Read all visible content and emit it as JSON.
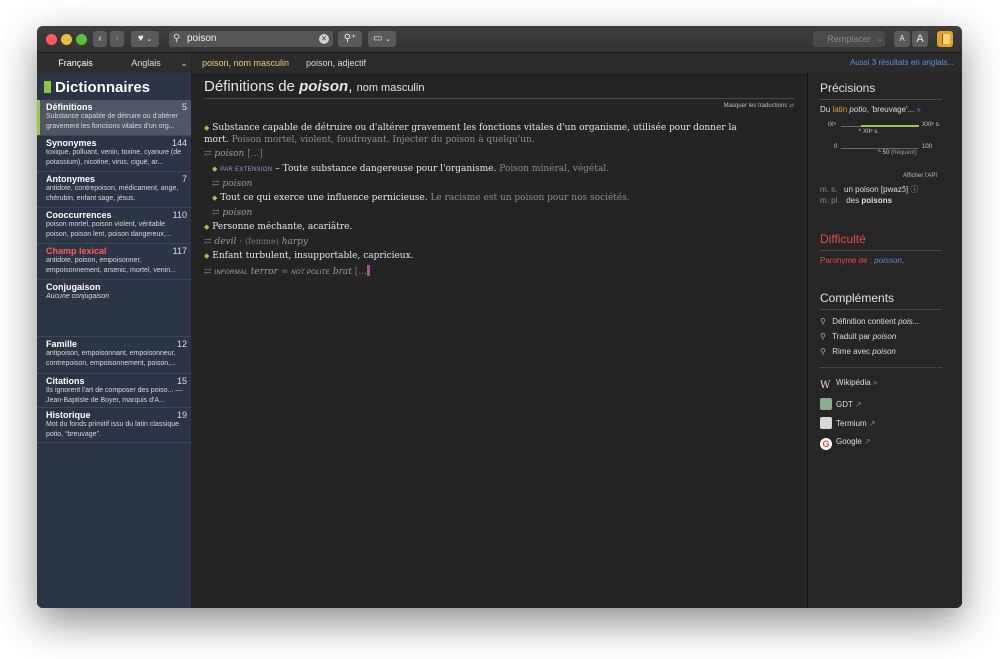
{
  "toolbar": {
    "search_query": "poison",
    "replace_label": "Remplacer",
    "small_a": "A",
    "big_a": "A"
  },
  "lang_tabs": [
    "Français",
    "Anglais"
  ],
  "sidebar": {
    "title": "Dictionnaires",
    "items": [
      {
        "title": "Définitions",
        "count": "5",
        "desc": "Substance capable de détruire ou d'altérer gravement les fonctions vitales d'un org..."
      },
      {
        "title": "Synonymes",
        "count": "144",
        "desc": "toxique, polluant, venin, toxine, cyanure (de potassium), nicotine, virus, ciguë, ar..."
      },
      {
        "title": "Antonymes",
        "count": "7",
        "desc": "antidote, contrepoison, médicament, ange, chérubin, enfant sage, jésus."
      },
      {
        "title": "Cooccurrences",
        "count": "110",
        "desc": "poison mortel, poison violent, véritable poison, poison lent, poison dangereux,..."
      },
      {
        "title": "Champ lexical",
        "count": "117",
        "desc": "antidote, poison, empoisonner, empoisonnement, arsenic, mortel, venin..."
      },
      {
        "title": "Conjugaison",
        "count": "",
        "desc": "Aucune conjugaison"
      },
      {
        "title": "Famille",
        "count": "12",
        "desc": "antipoison, empoisonnant, empoisonneur, contrepoison, empoisonnement, poison,..."
      },
      {
        "title": "Citations",
        "count": "15",
        "desc": "Ils ignorent l'art de composer des poiso... — Jean-Baptiste de Boyer, marquis d'A..."
      },
      {
        "title": "Historique",
        "count": "19",
        "desc": "Mot du fonds primitif issu du latin classique potio, “breuvage”."
      }
    ]
  },
  "content_tabs": {
    "tab1": "poison, nom masculin",
    "tab2": "poison, adjectif",
    "aussi": "Aussi 3 résultats en anglais..."
  },
  "main": {
    "title_prefix": "Définitions de",
    "title_word": "poison",
    "title_comma": ",",
    "title_pos": "nom masculin",
    "masquer": "Masquer les traductions",
    "definitions": [
      {
        "text": "Substance capable de détruire ou d'altérer gravement les fonctions vitales d'un organisme, utilisée pour donner la mort.",
        "example": "Poison mortel, violent, foudroyant. Injecter du poison à quelqu'un.",
        "translation": "poison",
        "ellipsis": "[...]"
      },
      {
        "label": "PAR EXTENSION",
        "text": "Toute substance dangereuse pour l'organisme.",
        "example": "Poison minéral, végétal.",
        "translation": "poison"
      },
      {
        "text": "Tout ce qui exerce une influence pernicieuse.",
        "example": "Le racisme est un poison pour nos sociétés.",
        "translation": "poison"
      },
      {
        "text": "Personne méchante, acariâtre.",
        "translation": "devil",
        "translation_extra": "(femme)",
        "translation2": "harpy"
      },
      {
        "text": "Enfant turbulent, insupportable, capricieux.",
        "label1": "INFORMAL",
        "translation": "terror",
        "label2": "NOT POLITE",
        "translation2": "brat",
        "ellipsis": "[..."
      }
    ]
  },
  "right": {
    "precisions_title": "Précisions",
    "origin_prefix": "Du",
    "origin_lang": "latin",
    "origin_word": "potio",
    "origin_gloss": ", 'breuvage'...",
    "century_start": "IXᵉ",
    "century_end": "XXIᵉ s.",
    "century_mark": "XIIᵉ s.",
    "freq_start": "0",
    "freq_end": "100",
    "freq_value": "50",
    "freq_label": "(fréquent)",
    "afficher_api": "Afficher l'API",
    "ms_label": "m. s.",
    "ms_value": "un poison [pwazɔ̃]",
    "mpl_label": "m. pl.",
    "mpl_value_prefix": "des",
    "mpl_value_word": "poisons",
    "difficulte_title": "Difficulté",
    "paronyme_prefix": "Paronyme de :",
    "paronyme_word": "poisson",
    "complements_title": "Compléments",
    "complements": [
      {
        "label": "Définition contient",
        "word": "pois..."
      },
      {
        "label": "Traduit par",
        "word": "poison"
      },
      {
        "label": "Rime avec",
        "word": "poison"
      }
    ],
    "links": [
      "Wikipédia",
      "GDT",
      "Termium",
      "Google"
    ]
  },
  "colors": {
    "accent_green": "#9bc84a",
    "link_blue": "#5a8fd8",
    "sidebar_bg": "#2c3546",
    "difficulty_red": "#e84a4a",
    "origin_orange": "#e59a3a"
  }
}
